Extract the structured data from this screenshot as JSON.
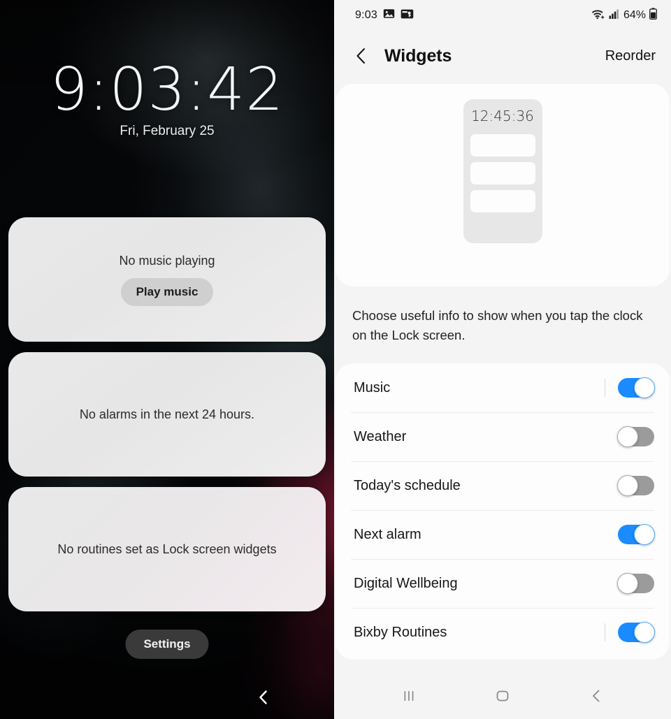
{
  "lockscreen": {
    "time": "9:03:42",
    "date": "Fri, February 25",
    "music_card": {
      "text": "No music playing",
      "button": "Play music"
    },
    "alarm_card": {
      "text": "No alarms in the next 24 hours."
    },
    "routine_card": {
      "text": "No routines set as Lock screen widgets"
    },
    "settings_button": "Settings",
    "back_icon": "chevron-left-icon",
    "wallpaper_colors": {
      "dark": "#050608",
      "teal": "#6e878c",
      "crimson": "#ba244a"
    }
  },
  "settings": {
    "statusbar": {
      "time": "9:03",
      "icons": [
        "image-icon",
        "card-key-icon"
      ],
      "right_icons": [
        "wifi-icon",
        "signal-icon"
      ],
      "battery_percent": "64%",
      "battery_icon": "battery-icon"
    },
    "appbar": {
      "back_icon": "chevron-left-icon",
      "title": "Widgets",
      "action": "Reorder"
    },
    "preview": {
      "widget_time": "12:45:36",
      "row_count": 3
    },
    "description": "Choose useful info to show when you tap the clock on the Lock screen.",
    "rows": [
      {
        "label": "Music",
        "on": true,
        "divider": true
      },
      {
        "label": "Weather",
        "on": false,
        "divider": false
      },
      {
        "label": "Today's schedule",
        "on": false,
        "divider": false
      },
      {
        "label": "Next alarm",
        "on": true,
        "divider": false
      },
      {
        "label": "Digital Wellbeing",
        "on": false,
        "divider": false
      },
      {
        "label": "Bixby Routines",
        "on": true,
        "divider": true
      }
    ],
    "navbar": {
      "recents": "recents-icon",
      "home": "home-icon",
      "back": "back-icon"
    },
    "colors": {
      "toggle_on": "#1a8cff",
      "toggle_off": "#9b9b9b",
      "bg": "#f4f4f4",
      "card": "#fdfdfd"
    }
  }
}
